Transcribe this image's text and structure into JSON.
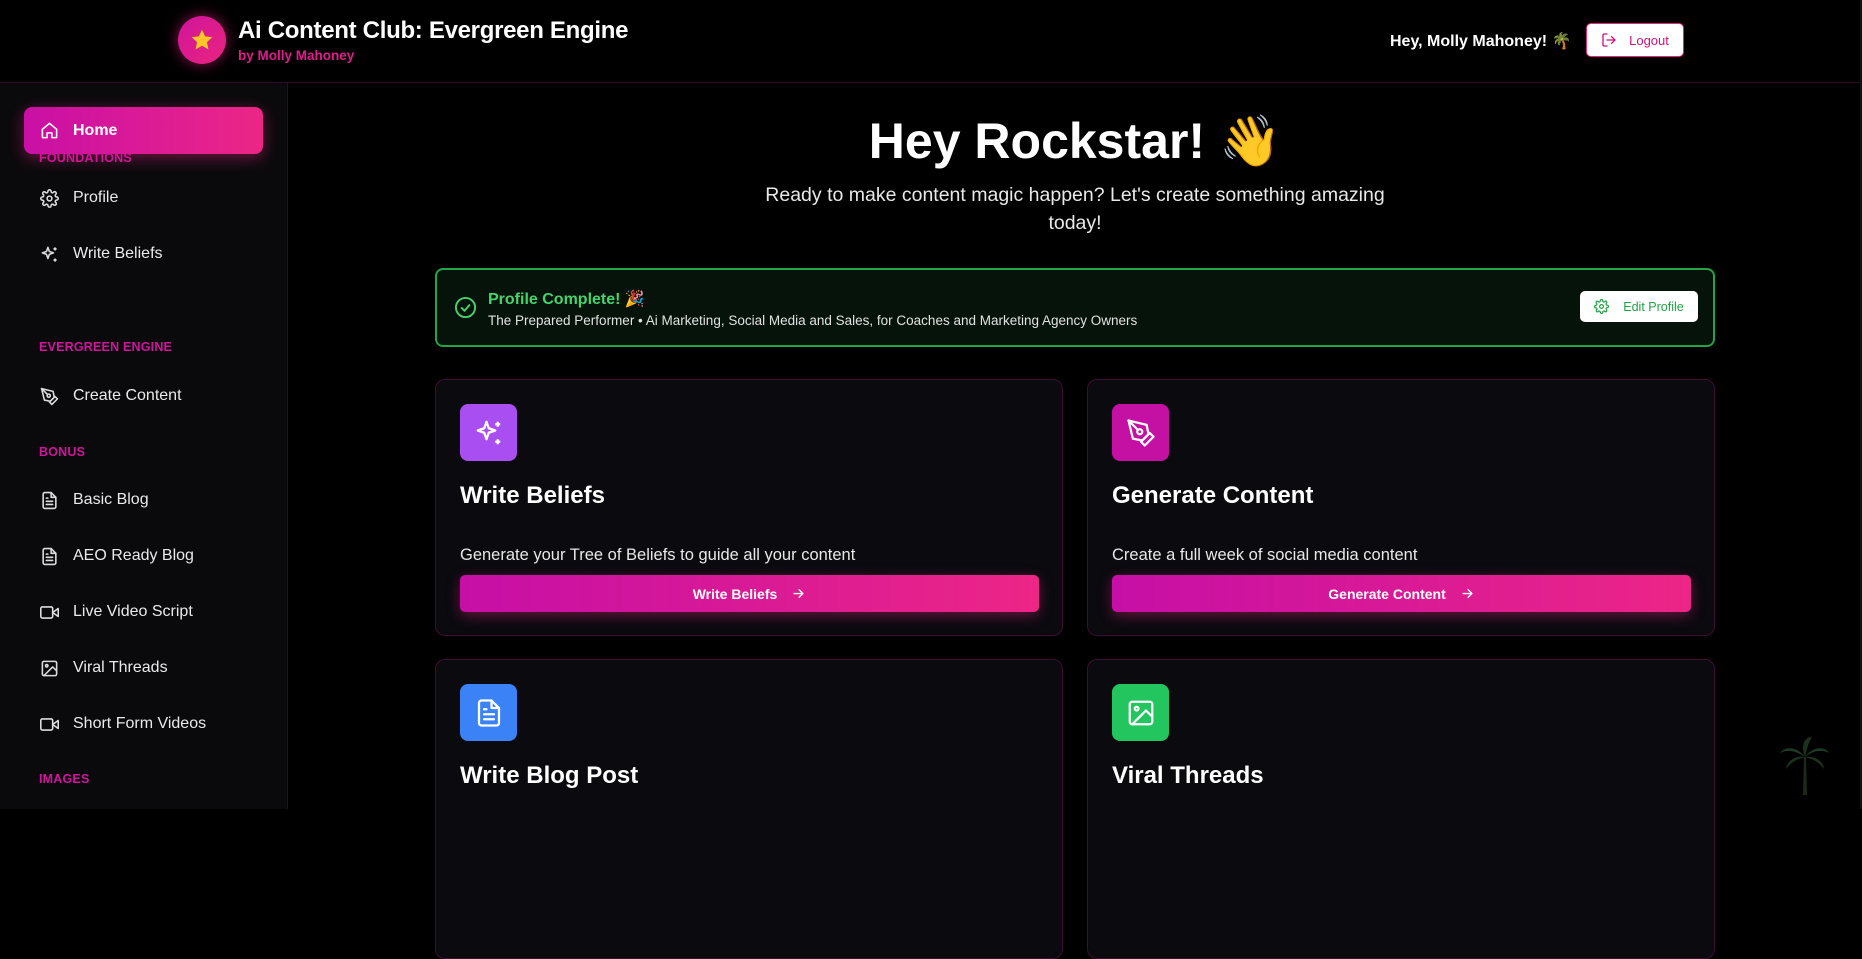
{
  "header": {
    "title": "Ai Content Club: Evergreen Engine",
    "subtitle": "by Molly Mahoney",
    "greeting": "Hey, Molly Mahoney! 🌴",
    "logout_label": "Logout",
    "logo_icon": "star-icon"
  },
  "sidebar": {
    "home_label": "Home",
    "sections": {
      "foundations": "FOUNDATIONS",
      "evergreen": "EVERGREEN ENGINE",
      "bonus": "BONUS",
      "images": "IMAGES"
    },
    "items": {
      "profile": "Profile",
      "write_beliefs": "Write Beliefs",
      "create_content": "Create Content",
      "basic_blog": "Basic Blog",
      "aeo_blog": "AEO Ready Blog",
      "live_video": "Live Video Script",
      "viral_threads": "Viral Threads",
      "short_form": "Short Form Videos"
    }
  },
  "main": {
    "hero_title": "Hey Rockstar! 👋",
    "hero_subtitle": "Ready to make content magic happen? Let's create something amazing today!",
    "profile_status": {
      "title": "Profile Complete! 🎉",
      "detail": "The Prepared Performer • Ai Marketing, Social Media and Sales, for Coaches and Marketing Agency Owners",
      "edit_label": "Edit Profile"
    },
    "cards": [
      {
        "title": "Write Beliefs",
        "description": "Generate your Tree of Beliefs to guide all your content",
        "button": "Write Beliefs",
        "icon": "sparkles-icon",
        "color": "#a94ff2"
      },
      {
        "title": "Generate Content",
        "description": "Create a full week of social media content",
        "button": "Generate Content",
        "icon": "pen-tool-icon",
        "color": "#c411a4"
      },
      {
        "title": "Write Blog Post",
        "icon": "document-icon",
        "color": "#3b82f6"
      },
      {
        "title": "Viral Threads",
        "icon": "image-icon",
        "color": "#22c55e"
      }
    ]
  },
  "colors": {
    "accent": "#e8247e",
    "accent_dark": "#c90fa6",
    "success": "#22a447"
  }
}
